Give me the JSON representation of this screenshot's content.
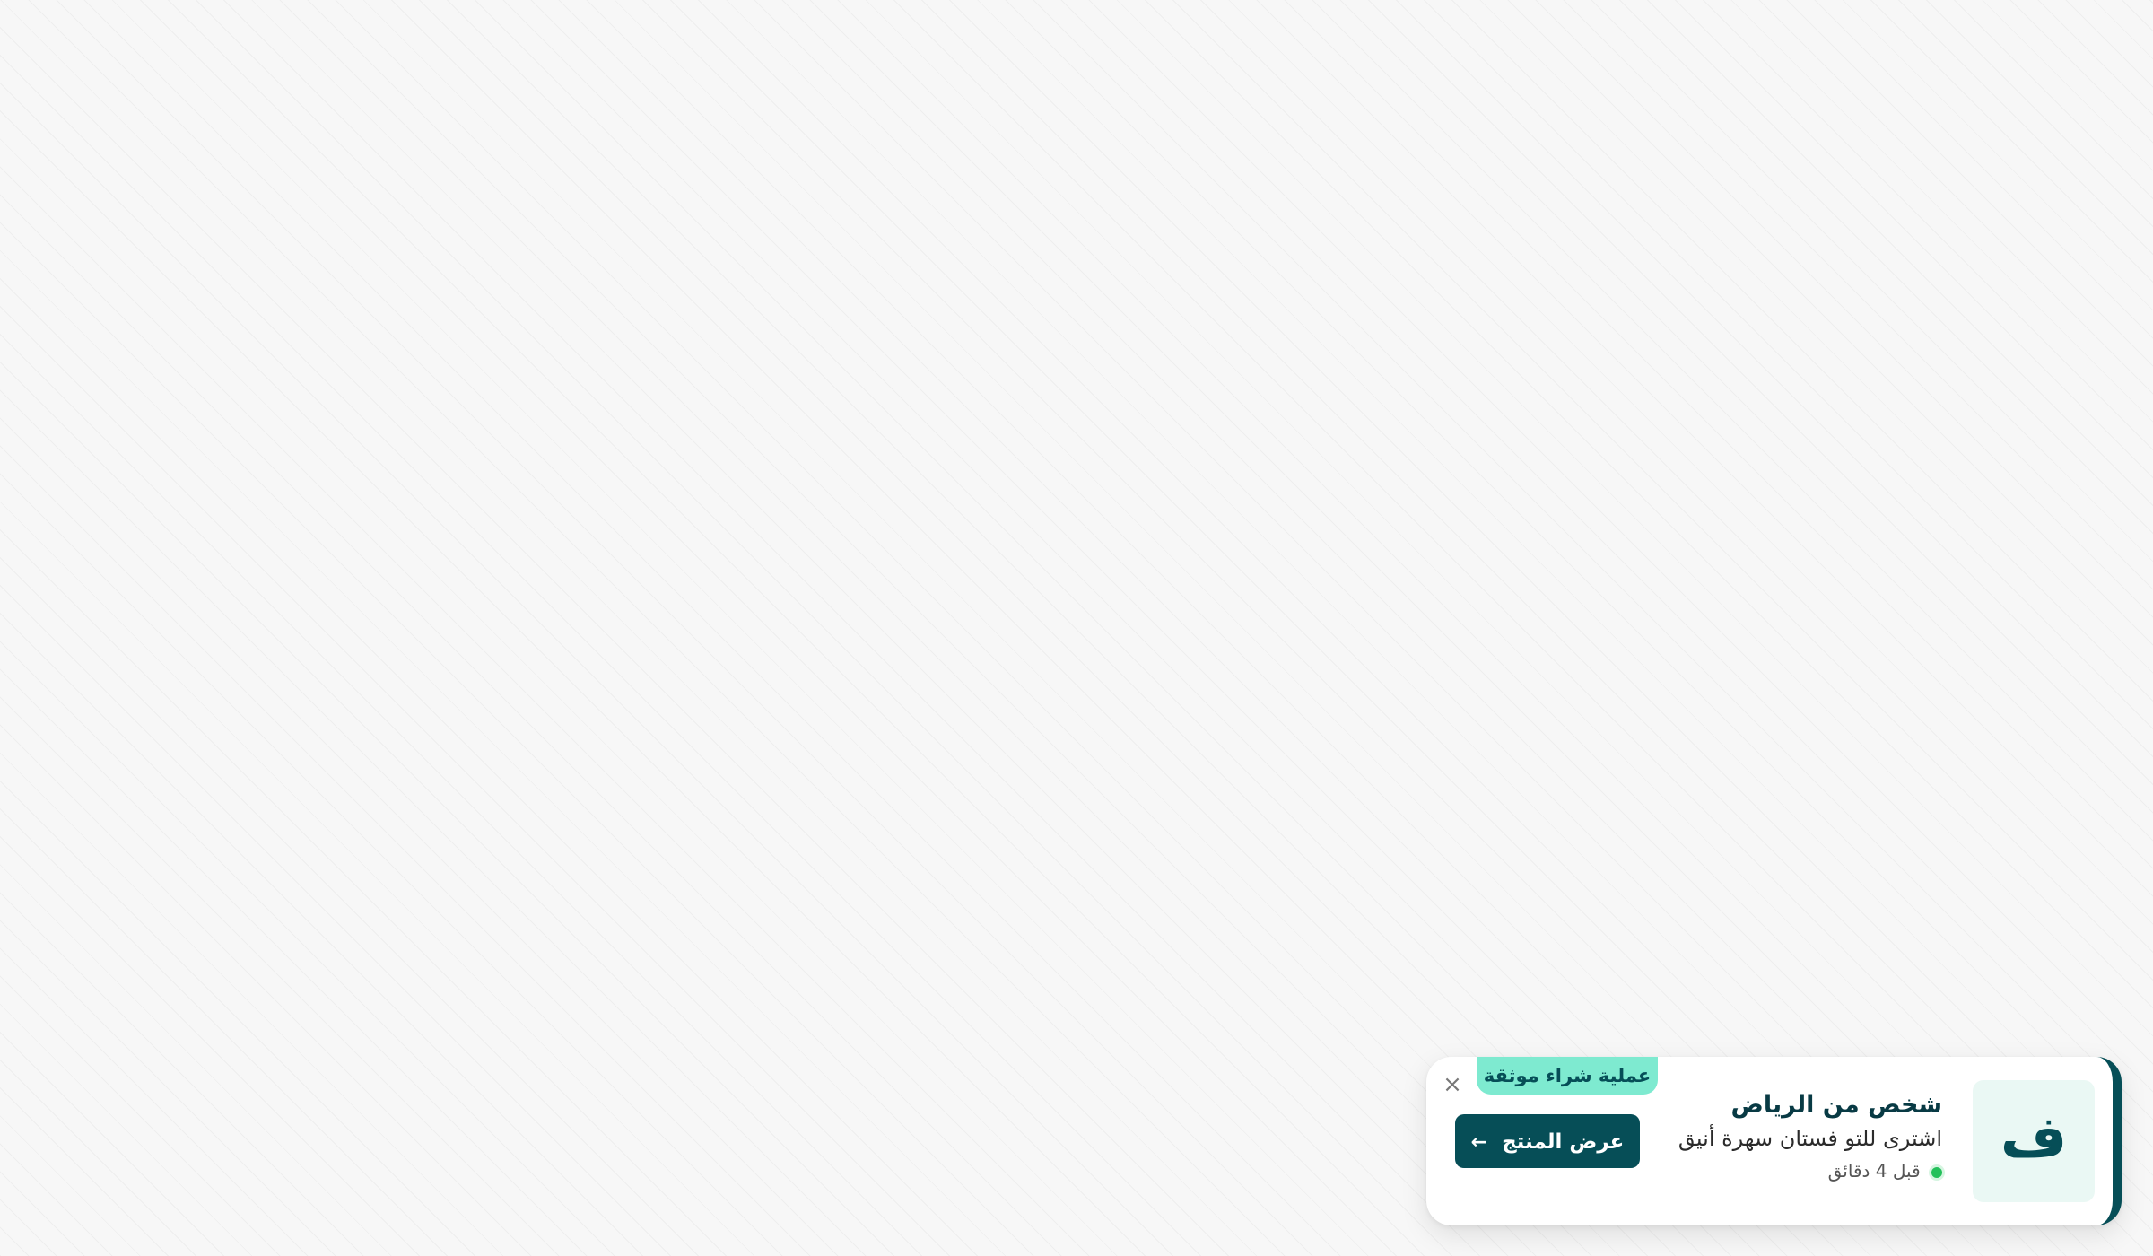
{
  "notification": {
    "badge": "عملية شراء موثقة",
    "close_icon": "×",
    "avatar_letter": "ف",
    "title": "شخص من الرياض",
    "description": "اشترى للتو فستان سهرة أنيق",
    "time": "قبل 4 دقائق",
    "cta_label": "عرض المنتج",
    "cta_icon": "←"
  },
  "colors": {
    "brand": "#064e57",
    "badge_bg": "#7eead0",
    "avatar_bg": "#eaf8f4",
    "online": "#23c05a"
  }
}
